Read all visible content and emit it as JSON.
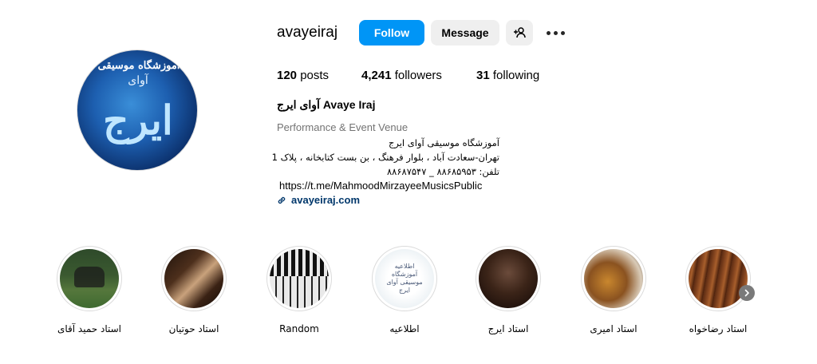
{
  "profile": {
    "username": "avayeiraj",
    "avatar_text": {
      "top": "آموزشگاه موسیقی",
      "middle": "آوای",
      "big": "ایرج"
    },
    "buttons": {
      "follow": "Follow",
      "message": "Message"
    },
    "stats": {
      "posts_count": "120",
      "posts_label": "posts",
      "followers_count": "4,241",
      "followers_label": "followers",
      "following_count": "31",
      "following_label": "following"
    },
    "full_name": "آوای ایرج Avaye Iraj",
    "category": "Performance & Event Venue",
    "bio_lines": [
      "آموزشگاه موسیقی آوای ایرج",
      "تهران-سعادت آباد ، بلوار فرهنگ ، بن بست کتابخانه ، پلاک 1",
      "تلفن: ۸۸۶۸۵۹۵۳ _ ۸۸۶۸۷۵۴۷"
    ],
    "bio_url": "https://t.me/MahmoodMirzayeeMusicsPublic",
    "website": "avayeiraj.com"
  },
  "highlights": [
    {
      "label": "استاد حمید آقای",
      "icon": "highlight-cover-performers"
    },
    {
      "label": "استاد حوتیان",
      "icon": "highlight-cover-piano-hands"
    },
    {
      "label": "Random",
      "icon": "highlight-cover-keyboard"
    },
    {
      "label": "اطلاعیه",
      "icon": "highlight-cover-announcement",
      "cover_text": "اطلاعیه آموزشگاه موسیقی آوای ایرج"
    },
    {
      "label": "استاد ایرج",
      "icon": "highlight-cover-portrait"
    },
    {
      "label": "استاد امیری",
      "icon": "highlight-cover-tar"
    },
    {
      "label": "استاد رضاخواه",
      "icon": "highlight-cover-santur"
    }
  ],
  "colors": {
    "follow_button": "#0095f6",
    "link": "#00376b",
    "secondary_text": "#737373"
  }
}
